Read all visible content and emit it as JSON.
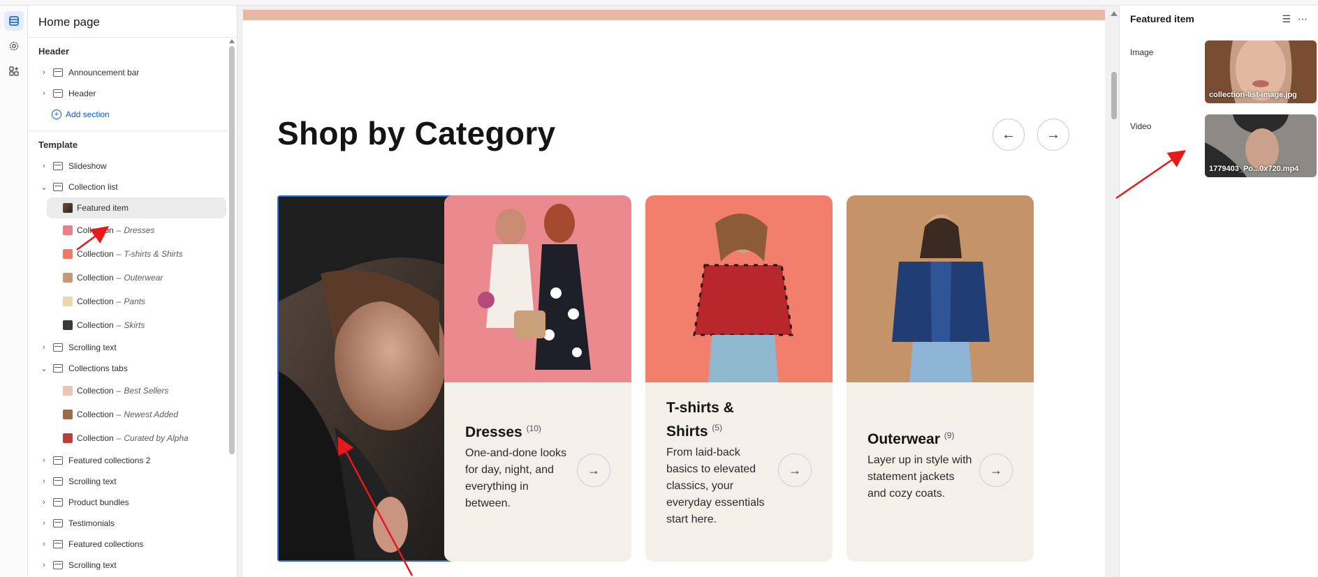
{
  "sidebar": {
    "title": "Home page",
    "header_group": {
      "title": "Header",
      "items": [
        {
          "label": "Announcement bar"
        },
        {
          "label": "Header"
        }
      ],
      "add_section": "Add section"
    },
    "template_group": {
      "title": "Template",
      "items": [
        {
          "label": "Slideshow"
        },
        {
          "label": "Collection list"
        }
      ],
      "collection_list_children": [
        {
          "label": "Featured item",
          "selected": true
        },
        {
          "prefix": "Collection",
          "sep": "–",
          "name": "Dresses"
        },
        {
          "prefix": "Collection",
          "sep": "–",
          "name": "T-shirts & Shirts"
        },
        {
          "prefix": "Collection",
          "sep": "–",
          "name": "Outerwear"
        },
        {
          "prefix": "Collection",
          "sep": "–",
          "name": "Pants"
        },
        {
          "prefix": "Collection",
          "sep": "–",
          "name": "Skirts"
        }
      ],
      "more_items_a": [
        {
          "label": "Scrolling text"
        },
        {
          "label": "Collections tabs"
        }
      ],
      "collections_tabs_children": [
        {
          "prefix": "Collection",
          "sep": "–",
          "name": "Best Sellers"
        },
        {
          "prefix": "Collection",
          "sep": "–",
          "name": "Newest Added"
        },
        {
          "prefix": "Collection",
          "sep": "–",
          "name": "Curated by Alpha"
        }
      ],
      "more_items_b": [
        {
          "label": "Featured collections 2"
        },
        {
          "label": "Scrolling text"
        },
        {
          "label": "Product bundles"
        },
        {
          "label": "Testimonials"
        },
        {
          "label": "Featured collections"
        },
        {
          "label": "Scrolling text"
        }
      ]
    }
  },
  "preview": {
    "heading": "Shop by Category",
    "prev_icon": "←",
    "next_icon": "→",
    "cards": [
      {
        "title": "Dresses",
        "count": "(10)",
        "desc": "One-and-done looks for day, night, and everything in between.",
        "arrow": "→"
      },
      {
        "title": "T-shirts & Shirts",
        "count": "(5)",
        "desc": "From laid-back basics to elevated classics, your everyday essentials start here.",
        "arrow": "→"
      },
      {
        "title": "Outerwear",
        "count": "(9)",
        "desc": "Layer up in style with statement jackets and cozy coats.",
        "arrow": "→"
      }
    ]
  },
  "settings": {
    "title": "Featured item",
    "image_label": "Image",
    "image_file": "collection-list-image.jpg",
    "video_label": "Video",
    "video_file": "1779403_Po...0x720.mp4"
  },
  "colors": {
    "accent": "#005bd3",
    "selection": "#2c6ecb",
    "annotation_arrow": "#e8191b"
  }
}
